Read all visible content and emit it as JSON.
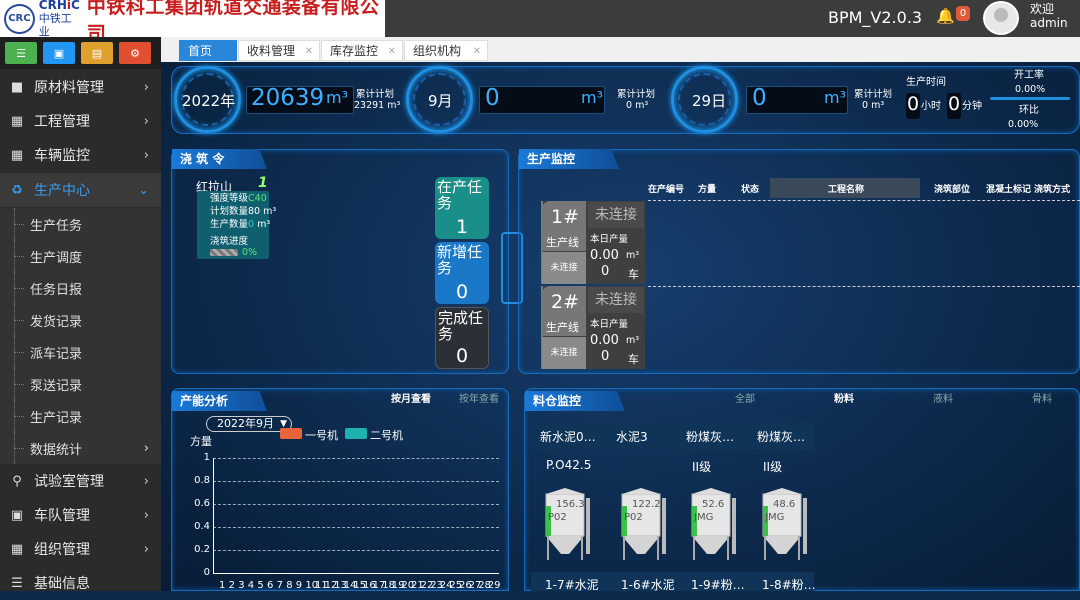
{
  "header": {
    "logo_emblem": "CRC",
    "logo_en_a": "CRH",
    "logo_en_b": "i",
    "logo_en_c": "C",
    "logo_cn": "中铁工业",
    "company": "中铁科工集团轨道交通装备有限公司",
    "version": "BPM_V2.0.3",
    "bell_icon": "bell-icon",
    "notify_count": "0",
    "welcome": "欢迎",
    "user": "admin"
  },
  "sidebar": {
    "tool_buttons": [
      {
        "icon": "database-icon",
        "color": "#4caf50"
      },
      {
        "icon": "truck-icon",
        "color": "#2196f3"
      },
      {
        "icon": "document-icon",
        "color": "#e0a030"
      },
      {
        "icon": "settings-icon",
        "color": "#e05030"
      }
    ],
    "menu": [
      {
        "label": "原材料管理",
        "icon": "cubes-icon"
      },
      {
        "label": "工程管理",
        "icon": "map-icon"
      },
      {
        "label": "车辆监控",
        "icon": "grid-icon"
      },
      {
        "label": "生产中心",
        "icon": "recycle-icon",
        "active": true
      }
    ],
    "submenu": [
      "生产任务",
      "生产调度",
      "任务日报",
      "发货记录",
      "派车记录",
      "泵送记录",
      "生产记录",
      "数据统计"
    ],
    "menu2": [
      {
        "label": "试验室管理",
        "icon": "flask-icon"
      },
      {
        "label": "车队管理",
        "icon": "truck-icon"
      },
      {
        "label": "组织管理",
        "icon": "grid-icon"
      },
      {
        "label": "基础信息",
        "icon": "list-icon"
      }
    ]
  },
  "tabs": [
    {
      "label": "首页"
    },
    {
      "label": "收料管理"
    },
    {
      "label": "库存监控"
    },
    {
      "label": "组织机构"
    }
  ],
  "stats": {
    "year": "2022年",
    "year_value": "20639",
    "unit": "m³",
    "plan_label": "累计计划",
    "year_plan": "23291",
    "year_plan_unit": "m³",
    "month": "9月",
    "month_value": "0",
    "month_plan": "0 m³",
    "day": "29日",
    "day_value": "0",
    "day_plan": "0 m³",
    "production_time_label": "生产时间",
    "hours": "0",
    "hours_unit": "小时",
    "minutes": "0",
    "minutes_unit": "分钟",
    "uptime_label": "开工率",
    "uptime": "0.00%",
    "ratio_label": "环比",
    "ratio": "0.00%"
  },
  "pour": {
    "title": "浇 筑 令",
    "site": "红拉山",
    "seq": "1",
    "strength_label": "强度等级",
    "strength": "C40",
    "plan_qty_label": "计划数量",
    "plan_qty": "80",
    "qty_unit": "m³",
    "prod_qty_label": "生产数量",
    "prod_qty": "0",
    "progress_label": "浇筑进度",
    "progress": "0%",
    "progress_frac": 0,
    "tasks": [
      {
        "label": "在产任务",
        "count": "1"
      },
      {
        "label": "新增任务",
        "count": "0"
      },
      {
        "label": "完成任务",
        "count": "0"
      }
    ]
  },
  "production": {
    "title": "生产监控",
    "columns": [
      "在产编号",
      "方量",
      "状态",
      "工程名称",
      "浇筑部位",
      "混凝土标记",
      "浇筑方式"
    ],
    "lines": [
      {
        "num": "1#",
        "name": "生产线",
        "state": "未连接",
        "status": "未连接",
        "today_label": "本日产量",
        "qty": "0.00",
        "qty_unit": "m³",
        "cars": "0",
        "car_unit": "车"
      },
      {
        "num": "2#",
        "name": "生产线",
        "state": "未连接",
        "status": "未连接",
        "today_label": "本日产量",
        "qty": "0.00",
        "qty_unit": "m³",
        "cars": "0",
        "car_unit": "车"
      }
    ]
  },
  "capacity": {
    "title": "产能分析",
    "by_month": "按月查看",
    "by_year": "按年查看",
    "month_select": "2022年9月",
    "legend": [
      {
        "name": "一号机",
        "color": "#e8643a"
      },
      {
        "name": "二号机",
        "color": "#1fb0b0"
      }
    ]
  },
  "chart_data": {
    "type": "bar",
    "ylabel": "方量",
    "ylim": [
      0,
      1
    ],
    "yticks": [
      "0",
      "0.2",
      "0.4",
      "0.6",
      "0.8",
      "1"
    ],
    "categories": [
      "1",
      "2",
      "3",
      "4",
      "5",
      "6",
      "7",
      "8",
      "9",
      "10",
      "11",
      "12",
      "13",
      "14",
      "15",
      "16",
      "17",
      "18",
      "19",
      "20",
      "21",
      "22",
      "23",
      "24",
      "25",
      "26",
      "27",
      "28",
      "29"
    ],
    "series": [
      {
        "name": "一号机",
        "values": [
          0,
          0,
          0,
          0,
          0,
          0,
          0,
          0,
          0,
          0,
          0,
          0,
          0,
          0,
          0,
          0,
          0,
          0,
          0,
          0,
          0,
          0,
          0,
          0,
          0,
          0,
          0,
          0,
          0
        ]
      },
      {
        "name": "二号机",
        "values": [
          0,
          0,
          0,
          0,
          0,
          0,
          0,
          0,
          0,
          0,
          0,
          0,
          0,
          0,
          0,
          0,
          0,
          0,
          0,
          0,
          0,
          0,
          0,
          0,
          0,
          0,
          0,
          0,
          0
        ]
      }
    ]
  },
  "silo": {
    "title": "料仓监控",
    "filters": [
      "全部",
      "粉料",
      "液料",
      "骨料"
    ],
    "items": [
      {
        "name": "新水泥0…",
        "spec": "P.O42.5",
        "value": "156.3",
        "code": "P02",
        "label": "1-7#水泥"
      },
      {
        "name": "水泥3",
        "spec": "",
        "value": "122.2",
        "code": "P02",
        "label": "1-6#水泥"
      },
      {
        "name": "粉煤灰…",
        "spec": "II级",
        "value": "52.6",
        "code": "JMG",
        "label": "1-9#粉…"
      },
      {
        "name": "粉煤灰…",
        "spec": "II级",
        "value": "48.6",
        "code": "JMG",
        "label": "1-8#粉…"
      }
    ]
  }
}
